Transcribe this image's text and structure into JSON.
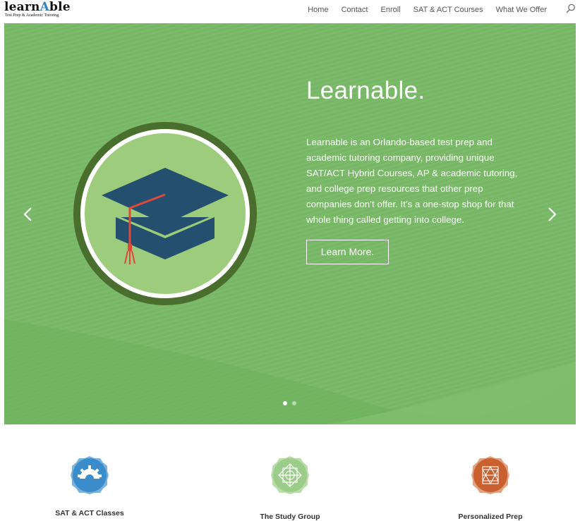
{
  "header": {
    "logo": {
      "word_start": "learn",
      "word_accent": "A",
      "word_end": "ble",
      "tagline": "Test Prep & Academic Tutoring"
    },
    "nav": [
      "Home",
      "Contact",
      "Enroll",
      "SAT & ACT Courses",
      "What We Offer"
    ],
    "search_icon": "search-icon"
  },
  "hero": {
    "title": "Learnable.",
    "body": "Learnable is an Orlando-based test prep and academic tutoring company, providing unique SAT/ACT Hybrid Courses, AP & academic tutoring, and college prep resources that other prep companies don’t offer. It’s a one-stop shop for that whole thing called getting into college.",
    "button": "Learn More.",
    "slides": 2,
    "active_slide": 1,
    "colors": {
      "background": "#77b766",
      "ring": "#4a6e2e",
      "circle": "#9ccc7c",
      "cap": "#244f6f",
      "tassel": "#e0483a"
    }
  },
  "features": [
    {
      "label": "SAT & ACT Classes",
      "icon": "gear-icon",
      "color": "#3a8ccb"
    },
    {
      "label": "The Study Group",
      "icon": "geometric-diamond-icon",
      "color": "#9ccc8a"
    },
    {
      "label": "Personalized Prep",
      "icon": "geometric-triangles-icon",
      "color": "#c8602f"
    }
  ]
}
